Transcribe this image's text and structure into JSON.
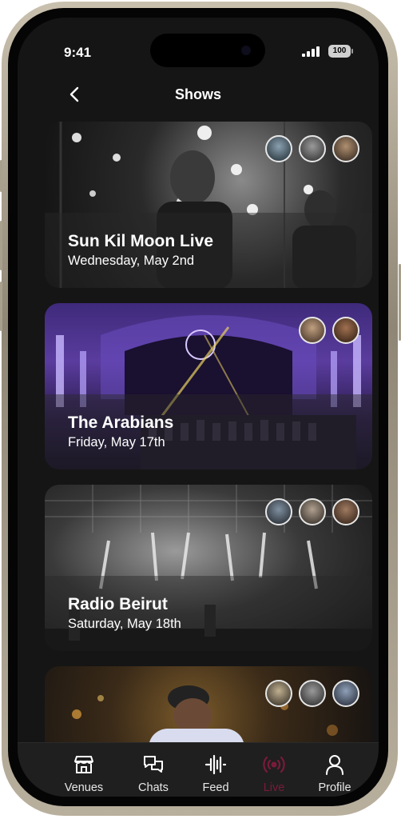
{
  "status_bar": {
    "time": "9:41",
    "battery": "100"
  },
  "header": {
    "title": "Shows",
    "back_icon": "chevron-left-icon"
  },
  "shows": [
    {
      "name": "Sun Kil Moon Live",
      "date": "Wednesday, May 2nd",
      "avatars": 3
    },
    {
      "name": "The Arabians",
      "date": "Friday, May 17th",
      "avatars": 2
    },
    {
      "name": "Radio Beirut",
      "date": "Saturday, May 18th",
      "avatars": 3
    },
    {
      "name": "",
      "date": "",
      "avatars": 3
    }
  ],
  "tabbar": {
    "items": [
      {
        "label": "Venues",
        "icon": "store-icon"
      },
      {
        "label": "Chats",
        "icon": "chat-bubbles-icon"
      },
      {
        "label": "Feed",
        "icon": "waveform-icon"
      },
      {
        "label": "Live",
        "icon": "broadcast-icon"
      },
      {
        "label": "Profile",
        "icon": "user-icon"
      }
    ],
    "active": "Live",
    "active_color": "#7a1a3a"
  }
}
